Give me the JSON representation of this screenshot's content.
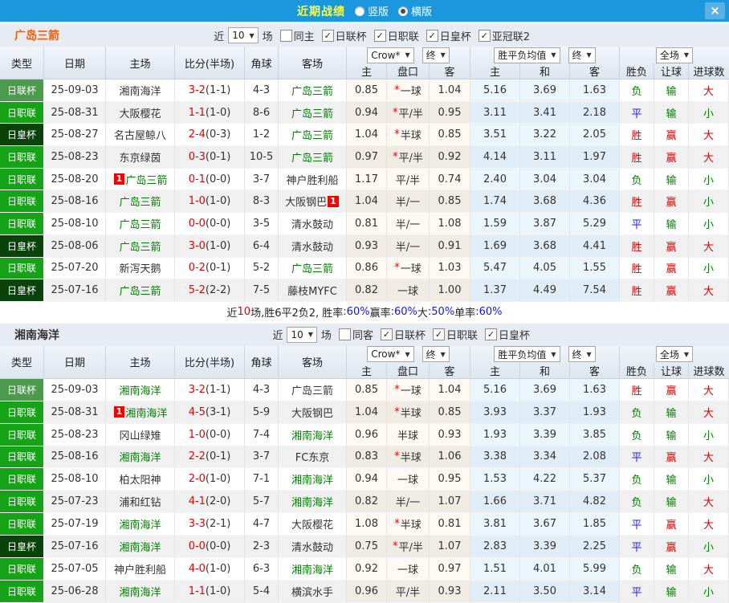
{
  "topbar": {
    "title": "近期战绩",
    "vertical_label": "竖版",
    "horizontal_label": "横版",
    "selected_layout": "横版",
    "close_glyph": "×"
  },
  "colors": {
    "topbar_blue": "#1b97dd",
    "title_yellow": "#ffff33",
    "badge_cup_green": "#4c9b4c",
    "badge_league_green": "#17a317",
    "badge_emperor_green": "#0a430a",
    "team_highlight_green": "#008000",
    "score_red": "#e60000",
    "result_win_red": "#dd0000",
    "result_draw_blue": "#2222dd",
    "result_lose_green": "#008000",
    "team1_name_orange": "#ff5a00"
  },
  "header": {
    "cols": [
      "类型",
      "日期",
      "主场",
      "比分(半场)",
      "角球",
      "客场"
    ],
    "crow_select": "Crow*",
    "final_select_1": "终",
    "avg_select": "胜平负均值",
    "final_select_2": "终",
    "full_select": "全场",
    "sub": [
      "主",
      "盘口",
      "客",
      "主",
      "和",
      "客",
      "胜负",
      "让球",
      "进球数"
    ]
  },
  "sections": [
    {
      "team": "广岛三箭",
      "filters": {
        "prefix": "近",
        "count": "10",
        "suffix": "场",
        "same_label": "同主",
        "same_checked": false,
        "leagues": [
          "日联杯",
          "日职联",
          "日皇杯",
          "亚冠联2"
        ]
      },
      "rows": [
        {
          "t": "日联杯",
          "tc": "cup",
          "date": "25-09-03",
          "home": "湘南海洋",
          "hHL": false,
          "hCard": "",
          "score": "3-2",
          "half": "(1-1)",
          "corner": "4-3",
          "away": "广岛三箭",
          "aHL": true,
          "aCard": "",
          "o1": "0.85",
          "star": true,
          "hc": "一球",
          "o2": "1.04",
          "w": "5.16",
          "d": "3.69",
          "l": "1.63",
          "r": [
            "负",
            "输",
            "大"
          ]
        },
        {
          "t": "日职联",
          "tc": "league",
          "date": "25-08-31",
          "home": "大阪樱花",
          "hHL": false,
          "hCard": "",
          "score": "1-1",
          "half": "(1-0)",
          "corner": "8-6",
          "away": "广岛三箭",
          "aHL": true,
          "aCard": "",
          "o1": "0.94",
          "star": true,
          "hc": "平/半",
          "o2": "0.95",
          "w": "3.11",
          "d": "3.41",
          "l": "2.18",
          "r": [
            "平",
            "输",
            "小"
          ]
        },
        {
          "t": "日皇杯",
          "tc": "emperor",
          "date": "25-08-27",
          "home": "名古屋鲸八",
          "hHL": false,
          "hCard": "",
          "score": "2-4",
          "half": "(0-3)",
          "corner": "1-2",
          "away": "广岛三箭",
          "aHL": true,
          "aCard": "",
          "o1": "1.04",
          "star": true,
          "hc": "半球",
          "o2": "0.85",
          "w": "3.51",
          "d": "3.22",
          "l": "2.05",
          "r": [
            "胜",
            "赢",
            "大"
          ]
        },
        {
          "t": "日职联",
          "tc": "league",
          "date": "25-08-23",
          "home": "东京绿茵",
          "hHL": false,
          "hCard": "",
          "score": "0-3",
          "half": "(0-1)",
          "corner": "10-5",
          "away": "广岛三箭",
          "aHL": true,
          "aCard": "",
          "o1": "0.97",
          "star": true,
          "hc": "平/半",
          "o2": "0.92",
          "w": "4.14",
          "d": "3.11",
          "l": "1.97",
          "r": [
            "胜",
            "赢",
            "大"
          ]
        },
        {
          "t": "日职联",
          "tc": "league",
          "date": "25-08-20",
          "home": "广岛三箭",
          "hHL": true,
          "hCard": "pre",
          "score": "0-1",
          "half": "(0-0)",
          "corner": "3-7",
          "away": "神户胜利船",
          "aHL": false,
          "aCard": "",
          "o1": "1.17",
          "star": false,
          "hc": "平/半",
          "o2": "0.74",
          "w": "2.40",
          "d": "3.04",
          "l": "3.04",
          "r": [
            "负",
            "输",
            "小"
          ]
        },
        {
          "t": "日职联",
          "tc": "league",
          "date": "25-08-16",
          "home": "广岛三箭",
          "hHL": true,
          "hCard": "",
          "score": "1-0",
          "half": "(1-0)",
          "corner": "8-3",
          "away": "大阪钢巴",
          "aHL": false,
          "aCard": "post",
          "o1": "1.04",
          "star": false,
          "hc": "半/一",
          "o2": "0.85",
          "w": "1.74",
          "d": "3.68",
          "l": "4.36",
          "r": [
            "胜",
            "赢",
            "小"
          ]
        },
        {
          "t": "日职联",
          "tc": "league",
          "date": "25-08-10",
          "home": "广岛三箭",
          "hHL": true,
          "hCard": "",
          "score": "0-0",
          "half": "(0-0)",
          "corner": "3-5",
          "away": "清水鼓动",
          "aHL": false,
          "aCard": "",
          "o1": "0.81",
          "star": false,
          "hc": "半/一",
          "o2": "1.08",
          "w": "1.59",
          "d": "3.87",
          "l": "5.29",
          "r": [
            "平",
            "输",
            "小"
          ]
        },
        {
          "t": "日皇杯",
          "tc": "emperor",
          "date": "25-08-06",
          "home": "广岛三箭",
          "hHL": true,
          "hCard": "",
          "score": "3-0",
          "half": "(1-0)",
          "corner": "6-4",
          "away": "清水鼓动",
          "aHL": false,
          "aCard": "",
          "o1": "0.93",
          "star": false,
          "hc": "半/一",
          "o2": "0.91",
          "w": "1.69",
          "d": "3.68",
          "l": "4.41",
          "r": [
            "胜",
            "赢",
            "大"
          ]
        },
        {
          "t": "日职联",
          "tc": "league",
          "date": "25-07-20",
          "home": "新泻天鹅",
          "hHL": false,
          "hCard": "",
          "score": "0-2",
          "half": "(0-1)",
          "corner": "5-2",
          "away": "广岛三箭",
          "aHL": true,
          "aCard": "",
          "o1": "0.86",
          "star": true,
          "hc": "一球",
          "o2": "1.03",
          "w": "5.47",
          "d": "4.05",
          "l": "1.55",
          "r": [
            "胜",
            "赢",
            "小"
          ]
        },
        {
          "t": "日皇杯",
          "tc": "emperor",
          "date": "25-07-16",
          "home": "广岛三箭",
          "hHL": true,
          "hCard": "",
          "score": "5-2",
          "half": "(2-2)",
          "corner": "7-5",
          "away": "藤枝MYFC",
          "aHL": false,
          "aCard": "",
          "o1": "0.82",
          "star": false,
          "hc": "一球",
          "o2": "1.00",
          "w": "1.37",
          "d": "4.49",
          "l": "7.54",
          "r": [
            "胜",
            "赢",
            "大"
          ]
        }
      ],
      "summary_parts": [
        {
          "t": "近",
          "c": "k"
        },
        {
          "t": "10",
          "c": "r"
        },
        {
          "t": "场,胜6平2负2, 胜率",
          "c": "k"
        },
        {
          "t": ":60%",
          "c": "b"
        },
        {
          "t": " 赢率",
          "c": "k"
        },
        {
          "t": ":60%",
          "c": "b"
        },
        {
          "t": " 大",
          "c": "k"
        },
        {
          "t": ":50%",
          "c": "b"
        },
        {
          "t": " 单率",
          "c": "k"
        },
        {
          "t": ":60%",
          "c": "b"
        }
      ]
    },
    {
      "team": "湘南海洋",
      "filters": {
        "prefix": "近",
        "count": "10",
        "suffix": "场",
        "same_label": "同客",
        "same_checked": false,
        "leagues": [
          "日联杯",
          "日职联",
          "日皇杯"
        ]
      },
      "rows": [
        {
          "t": "日联杯",
          "tc": "cup",
          "date": "25-09-03",
          "home": "湘南海洋",
          "hHL": true,
          "hCard": "",
          "score": "3-2",
          "half": "(1-1)",
          "corner": "4-3",
          "away": "广岛三箭",
          "aHL": false,
          "aCard": "",
          "o1": "0.85",
          "star": true,
          "hc": "一球",
          "o2": "1.04",
          "w": "5.16",
          "d": "3.69",
          "l": "1.63",
          "r": [
            "胜",
            "赢",
            "大"
          ]
        },
        {
          "t": "日职联",
          "tc": "league",
          "date": "25-08-31",
          "home": "湘南海洋",
          "hHL": true,
          "hCard": "pre",
          "score": "4-5",
          "half": "(3-1)",
          "corner": "5-9",
          "away": "大阪钢巴",
          "aHL": false,
          "aCard": "",
          "o1": "1.04",
          "star": true,
          "hc": "半球",
          "o2": "0.85",
          "w": "3.93",
          "d": "3.37",
          "l": "1.93",
          "r": [
            "负",
            "输",
            "大"
          ]
        },
        {
          "t": "日职联",
          "tc": "league",
          "date": "25-08-23",
          "home": "冈山绿雉",
          "hHL": false,
          "hCard": "",
          "score": "1-0",
          "half": "(0-0)",
          "corner": "7-4",
          "away": "湘南海洋",
          "aHL": true,
          "aCard": "",
          "o1": "0.96",
          "star": false,
          "hc": "半球",
          "o2": "0.93",
          "w": "1.93",
          "d": "3.39",
          "l": "3.85",
          "r": [
            "负",
            "输",
            "小"
          ]
        },
        {
          "t": "日职联",
          "tc": "league",
          "date": "25-08-16",
          "home": "湘南海洋",
          "hHL": true,
          "hCard": "",
          "score": "2-2",
          "half": "(0-1)",
          "corner": "3-7",
          "away": "FC东京",
          "aHL": false,
          "aCard": "",
          "o1": "0.83",
          "star": true,
          "hc": "半球",
          "o2": "1.06",
          "w": "3.38",
          "d": "3.34",
          "l": "2.08",
          "r": [
            "平",
            "赢",
            "大"
          ]
        },
        {
          "t": "日职联",
          "tc": "league",
          "date": "25-08-10",
          "home": "柏太阳神",
          "hHL": false,
          "hCard": "",
          "score": "2-0",
          "half": "(1-0)",
          "corner": "7-1",
          "away": "湘南海洋",
          "aHL": true,
          "aCard": "",
          "o1": "0.94",
          "star": false,
          "hc": "一球",
          "o2": "0.95",
          "w": "1.53",
          "d": "4.22",
          "l": "5.37",
          "r": [
            "负",
            "输",
            "小"
          ]
        },
        {
          "t": "日职联",
          "tc": "league",
          "date": "25-07-23",
          "home": "浦和红钻",
          "hHL": false,
          "hCard": "",
          "score": "4-1",
          "half": "(2-0)",
          "corner": "5-7",
          "away": "湘南海洋",
          "aHL": true,
          "aCard": "",
          "o1": "0.82",
          "star": false,
          "hc": "半/一",
          "o2": "1.07",
          "w": "1.66",
          "d": "3.71",
          "l": "4.82",
          "r": [
            "负",
            "输",
            "大"
          ]
        },
        {
          "t": "日职联",
          "tc": "league",
          "date": "25-07-19",
          "home": "湘南海洋",
          "hHL": true,
          "hCard": "",
          "score": "3-3",
          "half": "(2-1)",
          "corner": "4-7",
          "away": "大阪樱花",
          "aHL": false,
          "aCard": "",
          "o1": "1.08",
          "star": true,
          "hc": "半球",
          "o2": "0.81",
          "w": "3.81",
          "d": "3.67",
          "l": "1.85",
          "r": [
            "平",
            "赢",
            "大"
          ]
        },
        {
          "t": "日皇杯",
          "tc": "emperor",
          "date": "25-07-16",
          "home": "湘南海洋",
          "hHL": true,
          "hCard": "",
          "score": "0-0",
          "half": "(0-0)",
          "corner": "2-3",
          "away": "清水鼓动",
          "aHL": false,
          "aCard": "",
          "o1": "0.75",
          "star": true,
          "hc": "平/半",
          "o2": "1.07",
          "w": "2.83",
          "d": "3.39",
          "l": "2.25",
          "r": [
            "平",
            "赢",
            "小"
          ]
        },
        {
          "t": "日职联",
          "tc": "league",
          "date": "25-07-05",
          "home": "神户胜利船",
          "hHL": false,
          "hCard": "",
          "score": "4-0",
          "half": "(1-0)",
          "corner": "6-3",
          "away": "湘南海洋",
          "aHL": true,
          "aCard": "",
          "o1": "0.92",
          "star": false,
          "hc": "一球",
          "o2": "0.97",
          "w": "1.51",
          "d": "4.01",
          "l": "5.99",
          "r": [
            "负",
            "输",
            "大"
          ]
        },
        {
          "t": "日职联",
          "tc": "league",
          "date": "25-06-28",
          "home": "湘南海洋",
          "hHL": true,
          "hCard": "",
          "score": "1-1",
          "half": "(1-0)",
          "corner": "5-4",
          "away": "横滨水手",
          "aHL": false,
          "aCard": "",
          "o1": "0.96",
          "star": false,
          "hc": "平/半",
          "o2": "0.93",
          "w": "2.11",
          "d": "3.50",
          "l": "3.14",
          "r": [
            "平",
            "输",
            "小"
          ]
        }
      ]
    }
  ]
}
